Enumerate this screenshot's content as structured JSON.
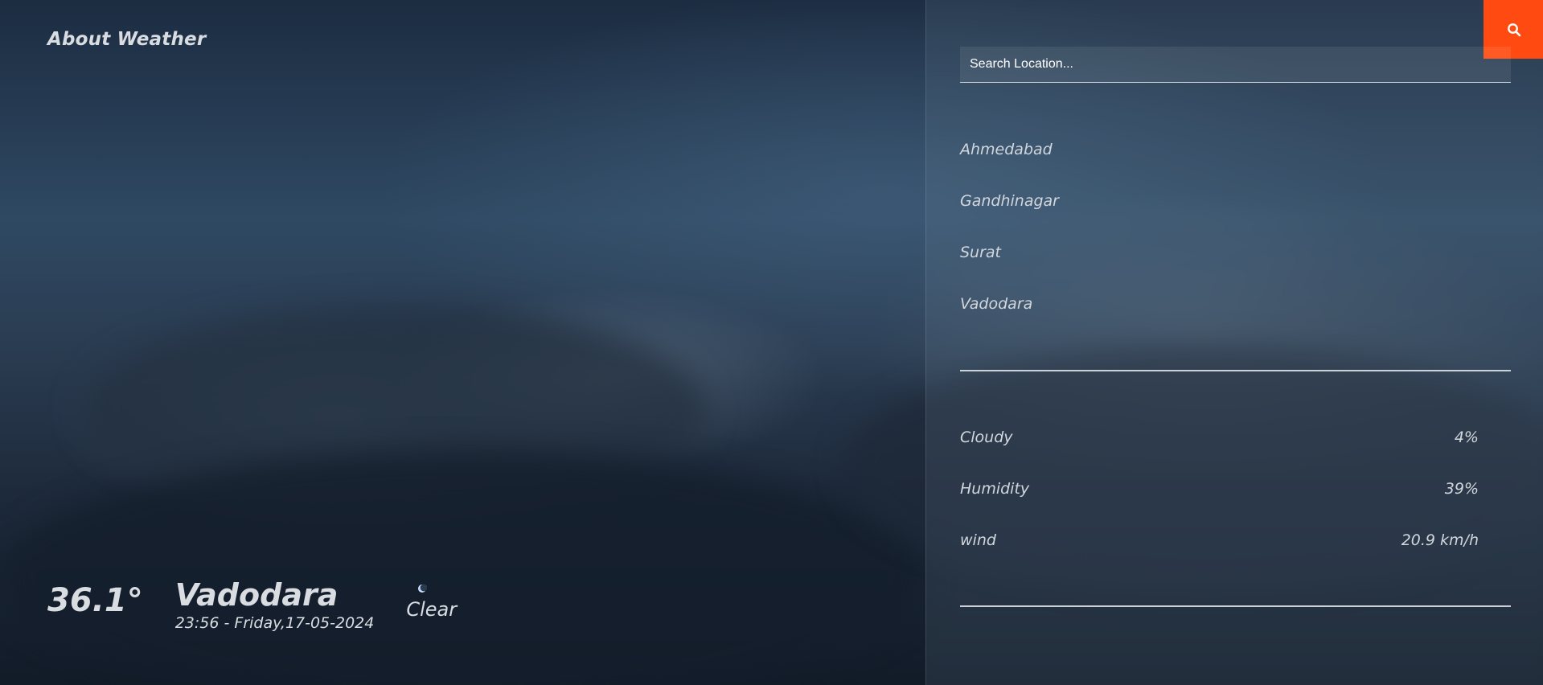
{
  "brand": "About Weather",
  "current": {
    "temperature": "36.1°",
    "city": "Vadodara",
    "datetime": "23:56 - Friday,17-05-2024",
    "condition": "Clear",
    "condition_icon": "moon-icon"
  },
  "search": {
    "placeholder": "Search Location...",
    "button_icon": "search-icon",
    "button_color": "#ff4b12"
  },
  "locations": [
    "Ahmedabad",
    "Gandhinagar",
    "Surat",
    "Vadodara"
  ],
  "details": [
    {
      "label": "Cloudy",
      "value": "4%"
    },
    {
      "label": "Humidity",
      "value": "39%"
    },
    {
      "label": "wind",
      "value": "20.9 km/h"
    }
  ]
}
